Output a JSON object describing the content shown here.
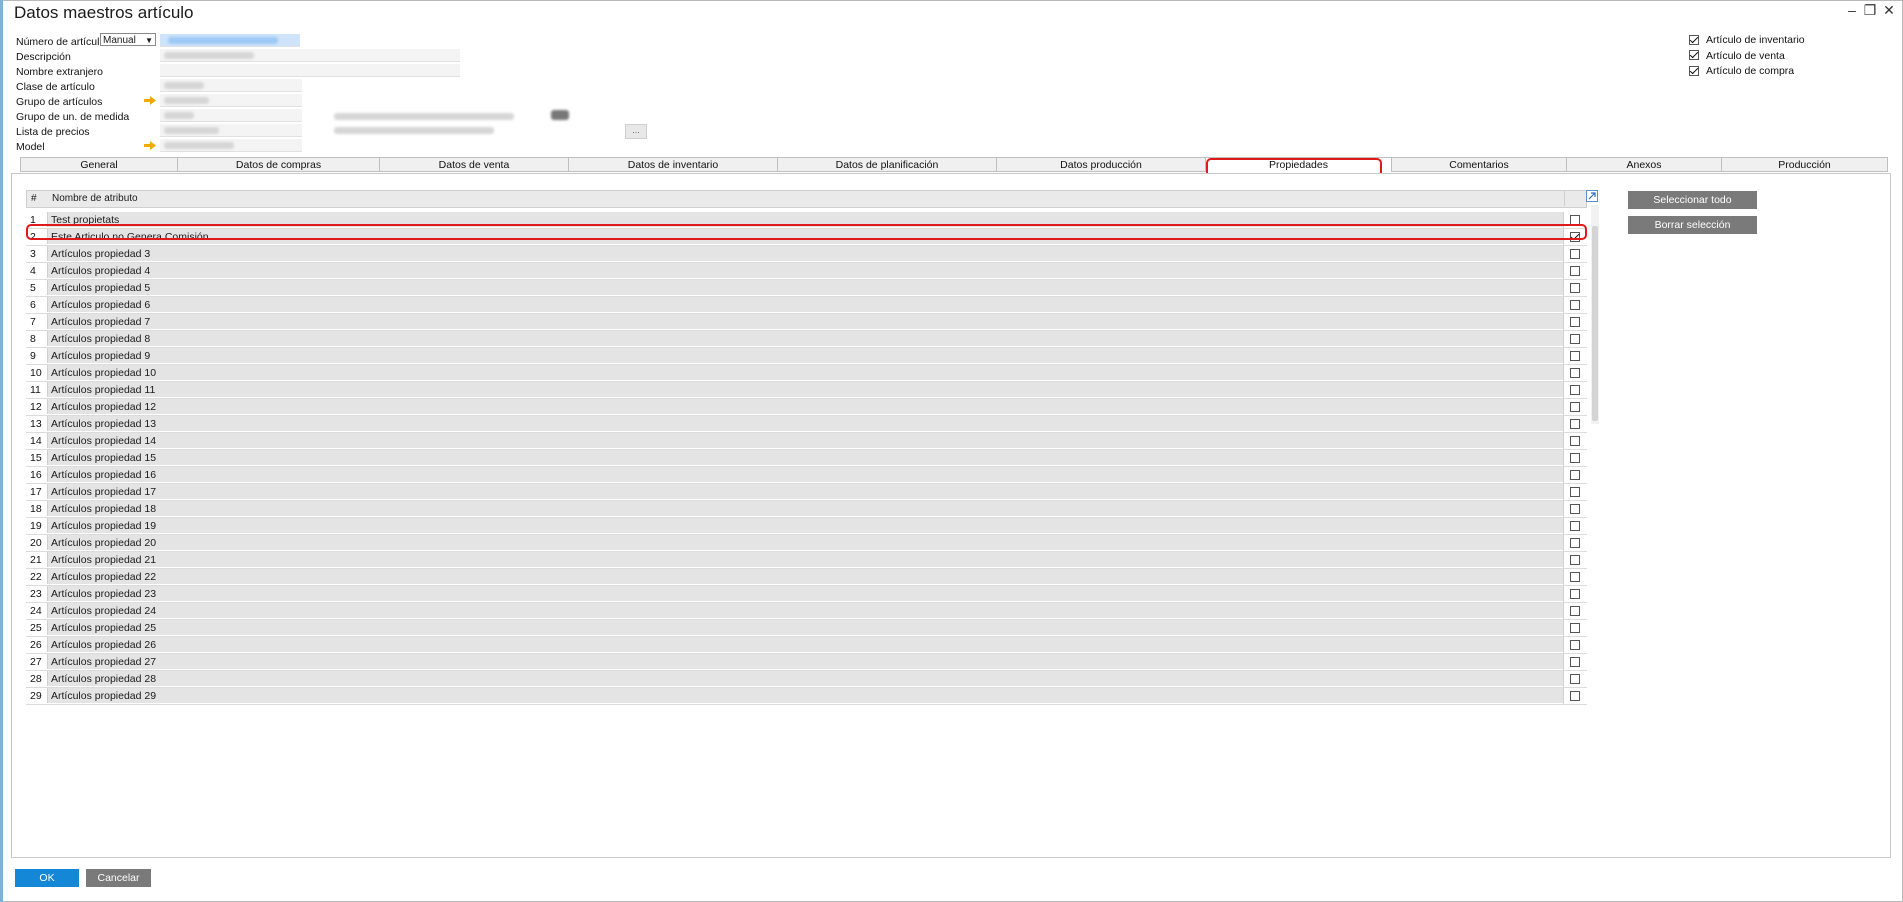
{
  "window": {
    "title": "Datos maestros artículo",
    "minimize": "–",
    "restore": "❐",
    "close": "✕"
  },
  "header": {
    "item_number_label": "Número de artículo",
    "item_number_mode": "Manual",
    "description_label": "Descripción",
    "foreign_name_label": "Nombre extranjero",
    "item_type_label": "Clase de artículo",
    "item_group_label": "Grupo de artículos",
    "uom_group_label": "Grupo de un. de medida",
    "price_list_label": "Lista de precios",
    "model_label": "Model",
    "ellipsis": "..."
  },
  "flags": [
    {
      "label": "Artículo de inventario",
      "checked": true
    },
    {
      "label": "Artículo de venta",
      "checked": true
    },
    {
      "label": "Artículo de compra",
      "checked": true
    }
  ],
  "tabs": [
    {
      "label": "General",
      "active": false
    },
    {
      "label": "Datos de compras",
      "active": false
    },
    {
      "label": "Datos de venta",
      "active": false
    },
    {
      "label": "Datos de inventario",
      "active": false
    },
    {
      "label": "Datos de planificación",
      "active": false
    },
    {
      "label": "Datos producción",
      "active": false
    },
    {
      "label": "Propiedades",
      "active": true
    },
    {
      "label": "Comentarios",
      "active": false
    },
    {
      "label": "Anexos",
      "active": false
    },
    {
      "label": "Producción",
      "active": false
    }
  ],
  "grid": {
    "col_num": "#",
    "col_name": "Nombre de atributo",
    "rows": [
      {
        "num": "1",
        "name": "Test propietats",
        "checked": false
      },
      {
        "num": "2",
        "name": "Este Articulo no Genera Comisión",
        "checked": true
      },
      {
        "num": "3",
        "name": "Artículos propiedad 3",
        "checked": false
      },
      {
        "num": "4",
        "name": "Artículos propiedad 4",
        "checked": false
      },
      {
        "num": "5",
        "name": "Artículos propiedad 5",
        "checked": false
      },
      {
        "num": "6",
        "name": "Artículos propiedad 6",
        "checked": false
      },
      {
        "num": "7",
        "name": "Artículos propiedad 7",
        "checked": false
      },
      {
        "num": "8",
        "name": "Artículos propiedad 8",
        "checked": false
      },
      {
        "num": "9",
        "name": "Artículos propiedad 9",
        "checked": false
      },
      {
        "num": "10",
        "name": "Artículos propiedad 10",
        "checked": false
      },
      {
        "num": "11",
        "name": "Artículos propiedad 11",
        "checked": false
      },
      {
        "num": "12",
        "name": "Artículos propiedad 12",
        "checked": false
      },
      {
        "num": "13",
        "name": "Artículos propiedad 13",
        "checked": false
      },
      {
        "num": "14",
        "name": "Artículos propiedad 14",
        "checked": false
      },
      {
        "num": "15",
        "name": "Artículos propiedad 15",
        "checked": false
      },
      {
        "num": "16",
        "name": "Artículos propiedad 16",
        "checked": false
      },
      {
        "num": "17",
        "name": "Artículos propiedad 17",
        "checked": false
      },
      {
        "num": "18",
        "name": "Artículos propiedad 18",
        "checked": false
      },
      {
        "num": "19",
        "name": "Artículos propiedad 19",
        "checked": false
      },
      {
        "num": "20",
        "name": "Artículos propiedad 20",
        "checked": false
      },
      {
        "num": "21",
        "name": "Artículos propiedad 21",
        "checked": false
      },
      {
        "num": "22",
        "name": "Artículos propiedad 22",
        "checked": false
      },
      {
        "num": "23",
        "name": "Artículos propiedad 23",
        "checked": false
      },
      {
        "num": "24",
        "name": "Artículos propiedad 24",
        "checked": false
      },
      {
        "num": "25",
        "name": "Artículos propiedad 25",
        "checked": false
      },
      {
        "num": "26",
        "name": "Artículos propiedad 26",
        "checked": false
      },
      {
        "num": "27",
        "name": "Artículos propiedad 27",
        "checked": false
      },
      {
        "num": "28",
        "name": "Artículos propiedad 28",
        "checked": false
      },
      {
        "num": "29",
        "name": "Artículos propiedad 29",
        "checked": false
      }
    ]
  },
  "actions": {
    "select_all": "Seleccionar todo",
    "clear_selection": "Borrar selección"
  },
  "footer": {
    "ok": "OK",
    "cancel": "Cancelar"
  },
  "colors": {
    "highlight": "#e01a1a",
    "ok_button": "#1487d6",
    "gray_button": "#7a7a7a",
    "arrow_link": "#f2a900"
  }
}
